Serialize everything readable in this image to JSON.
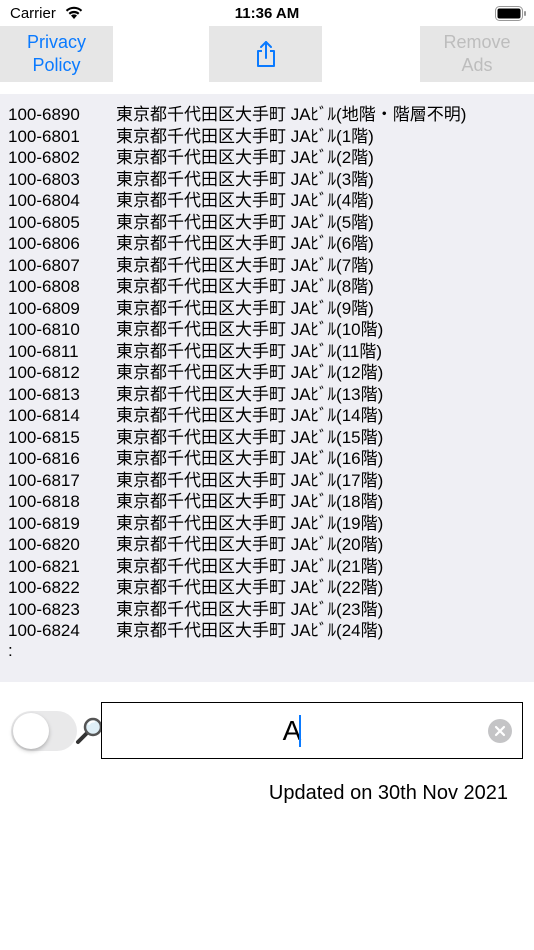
{
  "status_bar": {
    "carrier": "Carrier",
    "time": "11:36 AM"
  },
  "toolbar": {
    "privacy_label": "Privacy\nPolicy",
    "share_icon": "share-icon",
    "remove_ads_label": "Remove\nAds"
  },
  "results": {
    "rows": [
      {
        "code": "100-6890",
        "address": "東京都千代田区大手町 JAﾋﾞﾙ(地階・階層不明)"
      },
      {
        "code": "100-6801",
        "address": "東京都千代田区大手町 JAﾋﾞﾙ(1階)"
      },
      {
        "code": "100-6802",
        "address": "東京都千代田区大手町 JAﾋﾞﾙ(2階)"
      },
      {
        "code": "100-6803",
        "address": "東京都千代田区大手町 JAﾋﾞﾙ(3階)"
      },
      {
        "code": "100-6804",
        "address": "東京都千代田区大手町 JAﾋﾞﾙ(4階)"
      },
      {
        "code": "100-6805",
        "address": "東京都千代田区大手町 JAﾋﾞﾙ(5階)"
      },
      {
        "code": "100-6806",
        "address": "東京都千代田区大手町 JAﾋﾞﾙ(6階)"
      },
      {
        "code": "100-6807",
        "address": "東京都千代田区大手町 JAﾋﾞﾙ(7階)"
      },
      {
        "code": "100-6808",
        "address": "東京都千代田区大手町 JAﾋﾞﾙ(8階)"
      },
      {
        "code": "100-6809",
        "address": "東京都千代田区大手町 JAﾋﾞﾙ(9階)"
      },
      {
        "code": "100-6810",
        "address": "東京都千代田区大手町 JAﾋﾞﾙ(10階)"
      },
      {
        "code": "100-6811",
        "address": "東京都千代田区大手町 JAﾋﾞﾙ(11階)"
      },
      {
        "code": "100-6812",
        "address": "東京都千代田区大手町 JAﾋﾞﾙ(12階)"
      },
      {
        "code": "100-6813",
        "address": "東京都千代田区大手町 JAﾋﾞﾙ(13階)"
      },
      {
        "code": "100-6814",
        "address": "東京都千代田区大手町 JAﾋﾞﾙ(14階)"
      },
      {
        "code": "100-6815",
        "address": "東京都千代田区大手町 JAﾋﾞﾙ(15階)"
      },
      {
        "code": "100-6816",
        "address": "東京都千代田区大手町 JAﾋﾞﾙ(16階)"
      },
      {
        "code": "100-6817",
        "address": "東京都千代田区大手町 JAﾋﾞﾙ(17階)"
      },
      {
        "code": "100-6818",
        "address": "東京都千代田区大手町 JAﾋﾞﾙ(18階)"
      },
      {
        "code": "100-6819",
        "address": "東京都千代田区大手町 JAﾋﾞﾙ(19階)"
      },
      {
        "code": "100-6820",
        "address": "東京都千代田区大手町 JAﾋﾞﾙ(20階)"
      },
      {
        "code": "100-6821",
        "address": "東京都千代田区大手町 JAﾋﾞﾙ(21階)"
      },
      {
        "code": "100-6822",
        "address": "東京都千代田区大手町 JAﾋﾞﾙ(22階)"
      },
      {
        "code": "100-6823",
        "address": "東京都千代田区大手町 JAﾋﾞﾙ(23階)"
      },
      {
        "code": "100-6824",
        "address": "東京都千代田区大手町 JAﾋﾞﾙ(24階)"
      }
    ],
    "more_indicator": ":"
  },
  "search": {
    "toggle_on": false,
    "value": "A",
    "clear_icon": "clear-icon"
  },
  "footer": {
    "updated": "Updated on 30th Nov 2021"
  },
  "colors": {
    "accent": "#0a7aff",
    "button_bg": "#e6e6e6",
    "results_bg": "#efeff4",
    "disabled_text": "#bdbdbd"
  }
}
